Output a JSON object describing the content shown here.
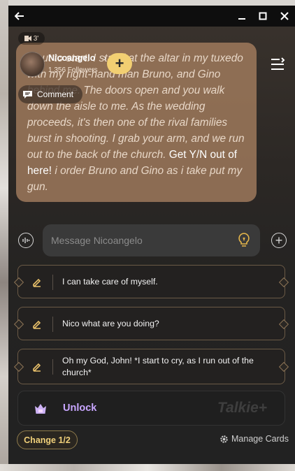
{
  "window": {
    "min_glyph": "—",
    "max_glyph": "▢",
    "close_glyph": "✕",
    "back_glyph": "←"
  },
  "badge": {
    "text": "3'"
  },
  "profile": {
    "name": "Nicoangelo",
    "followers": "1,356 Followers"
  },
  "comment": {
    "label": "Comment"
  },
  "message": {
    "lines": [
      {
        "text": "...out to start. I stand at the altar in my tuxedo with my right-hand man Bruno, and Gino behind me. The doors open and you walk down the aisle to me. As the wedding proceeds, it's then one of the rival families burst in shooting. I grab your arm, and we run out to the back of the church. ",
        "speech": false
      },
      {
        "text": "Get Y/N out of here!",
        "speech": true
      },
      {
        "text": " i order Bruno and Gino as i take put my gun.",
        "speech": false
      }
    ]
  },
  "input": {
    "placeholder": "Message Nicoangelo"
  },
  "suggestions": [
    "I can take care of myself.",
    "Nico what are you doing?",
    "Oh my God, John! *I start to cry, as I run out of the church*"
  ],
  "unlock": {
    "label": "Unlock",
    "watermark": "Talkie+"
  },
  "footer": {
    "change_label": "Change 1/2",
    "manage_label": "Manage Cards"
  },
  "colors": {
    "accent": "#f2cf72",
    "unlock": "#c8a6ff",
    "bubble": "#a88060"
  }
}
